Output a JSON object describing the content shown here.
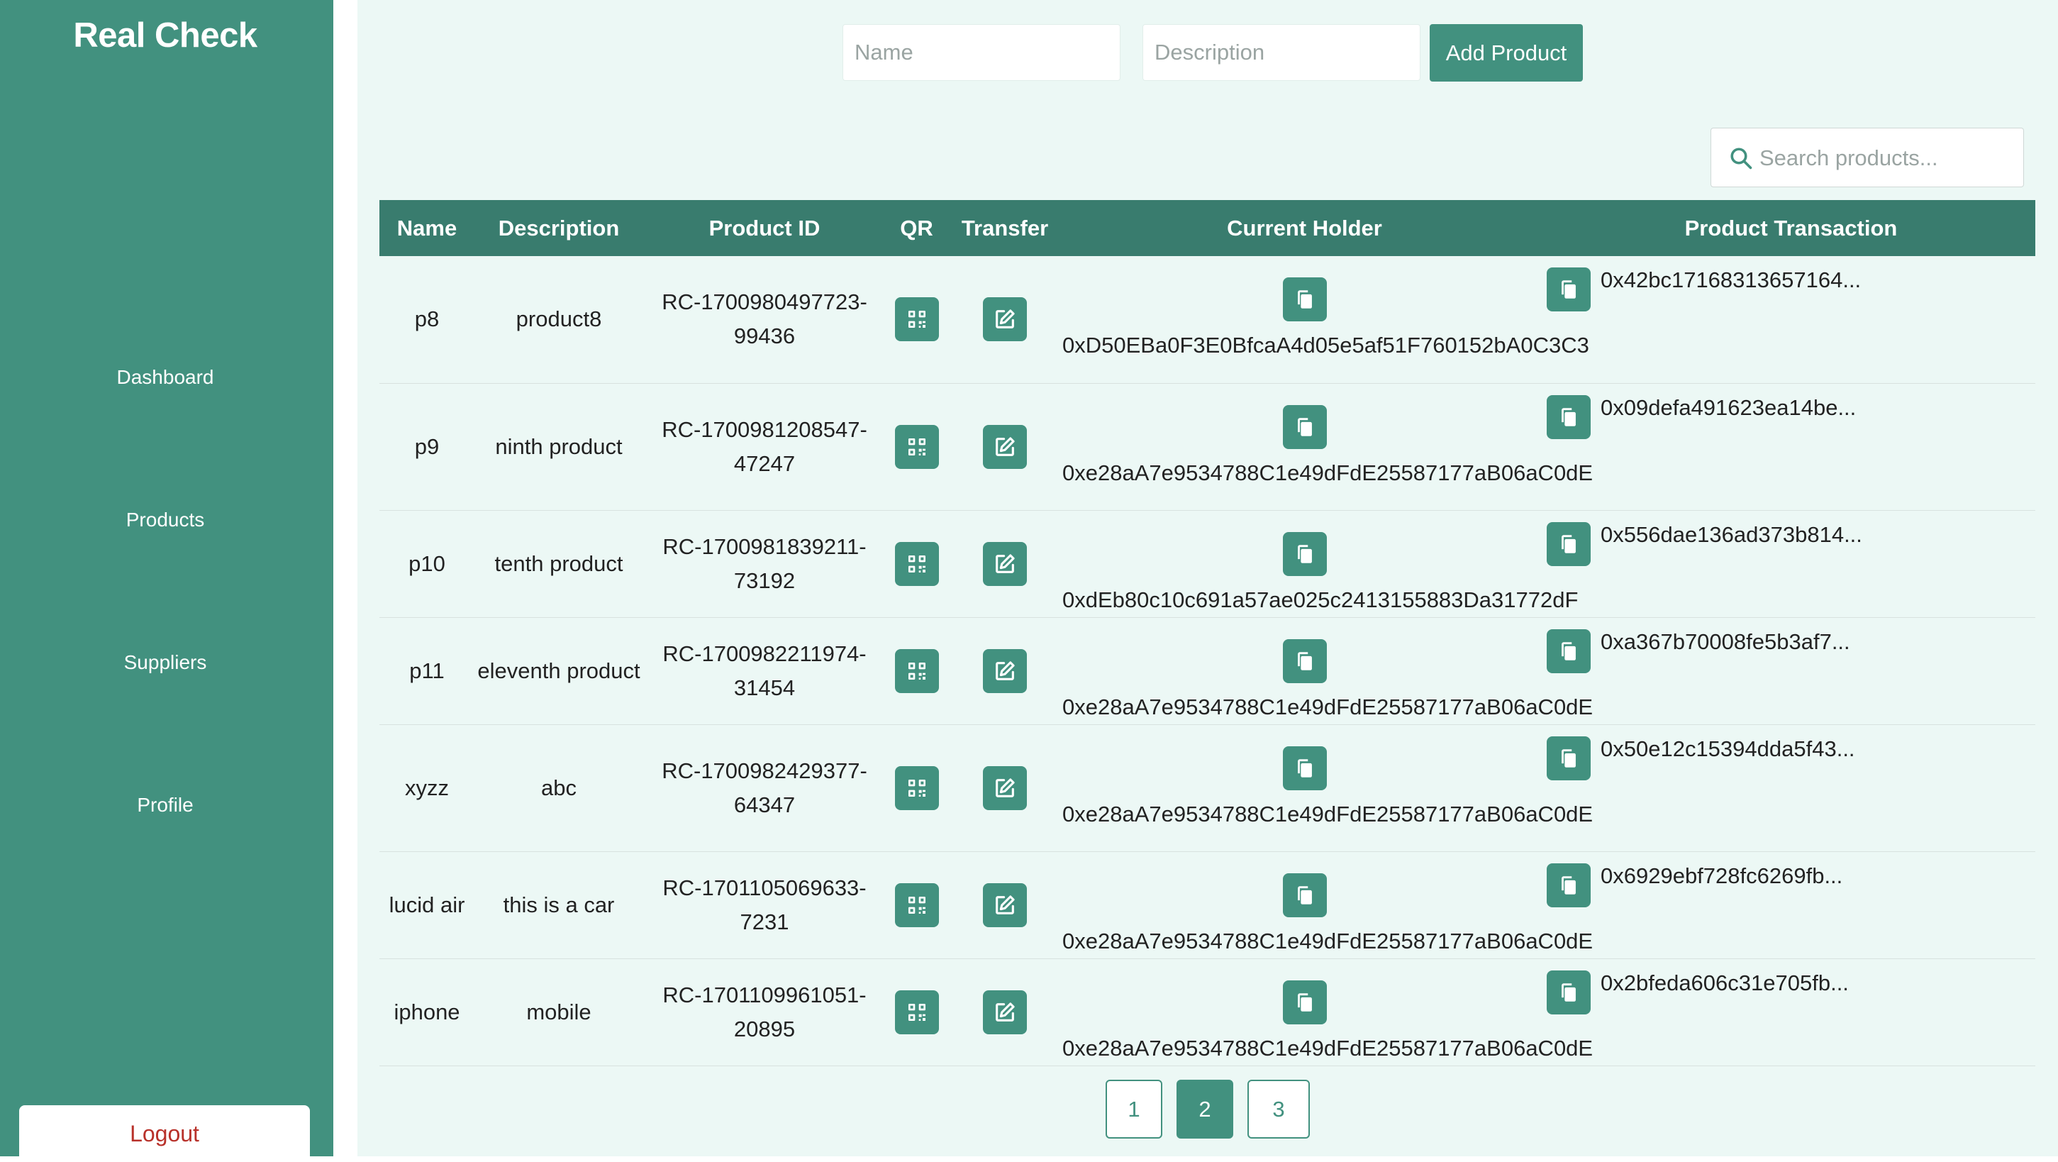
{
  "app": {
    "title": "Real Check"
  },
  "sidebar": {
    "items": [
      {
        "label": "Dashboard"
      },
      {
        "label": "Products"
      },
      {
        "label": "Suppliers"
      },
      {
        "label": "Profile"
      }
    ],
    "logout_label": "Logout"
  },
  "form": {
    "name_placeholder": "Name",
    "description_placeholder": "Description",
    "add_label": "Add Product"
  },
  "search": {
    "placeholder": "Search products..."
  },
  "table": {
    "headers": [
      "Name",
      "Description",
      "Product ID",
      "QR",
      "Transfer",
      "Current Holder",
      "Product Transaction"
    ],
    "rows": [
      {
        "name": "p8",
        "description": "product8",
        "product_id": "RC-1700980497723-99436",
        "holder": "0xD50EBa0F3E0BfcaA4d05e5af51F760152bA0C3C3",
        "tx": "0x42bc17168313657164..."
      },
      {
        "name": "p9",
        "description": "ninth product",
        "product_id": "RC-1700981208547-47247",
        "holder": "0xe28aA7e9534788C1e49dFdE25587177aB06aC0dE",
        "tx": "0x09defa491623ea14be..."
      },
      {
        "name": "p10",
        "description": "tenth product",
        "product_id": "RC-1700981839211-73192",
        "holder": "0xdEb80c10c691a57ae025c2413155883Da31772dF",
        "tx": "0x556dae136ad373b814..."
      },
      {
        "name": "p11",
        "description": "eleventh product",
        "product_id": "RC-1700982211974-31454",
        "holder": "0xe28aA7e9534788C1e49dFdE25587177aB06aC0dE",
        "tx": "0xa367b70008fe5b3af7..."
      },
      {
        "name": "xyzz",
        "description": "abc",
        "product_id": "RC-1700982429377-64347",
        "holder": "0xe28aA7e9534788C1e49dFdE25587177aB06aC0dE",
        "tx": "0x50e12c15394dda5f43..."
      },
      {
        "name": "lucid air",
        "description": "this is a car",
        "product_id": "RC-1701105069633-7231",
        "holder": "0xe28aA7e9534788C1e49dFdE25587177aB06aC0dE",
        "tx": "0x6929ebf728fc6269fb..."
      },
      {
        "name": "iphone",
        "description": "mobile",
        "product_id": "RC-1701109961051-20895",
        "holder": "0xe28aA7e9534788C1e49dFdE25587177aB06aC0dE",
        "tx": "0x2bfeda606c31e705fb..."
      }
    ]
  },
  "pagination": {
    "pages": [
      "1",
      "2",
      "3"
    ],
    "current": "2"
  },
  "colors": {
    "primary": "#42917f",
    "header": "#397c6e",
    "background": "#ecf8f5",
    "logout_text": "#b8312a"
  },
  "icons": {
    "qr": "qr-code-icon",
    "transfer": "edit-icon",
    "copy": "copy-icon",
    "search": "search-icon"
  }
}
